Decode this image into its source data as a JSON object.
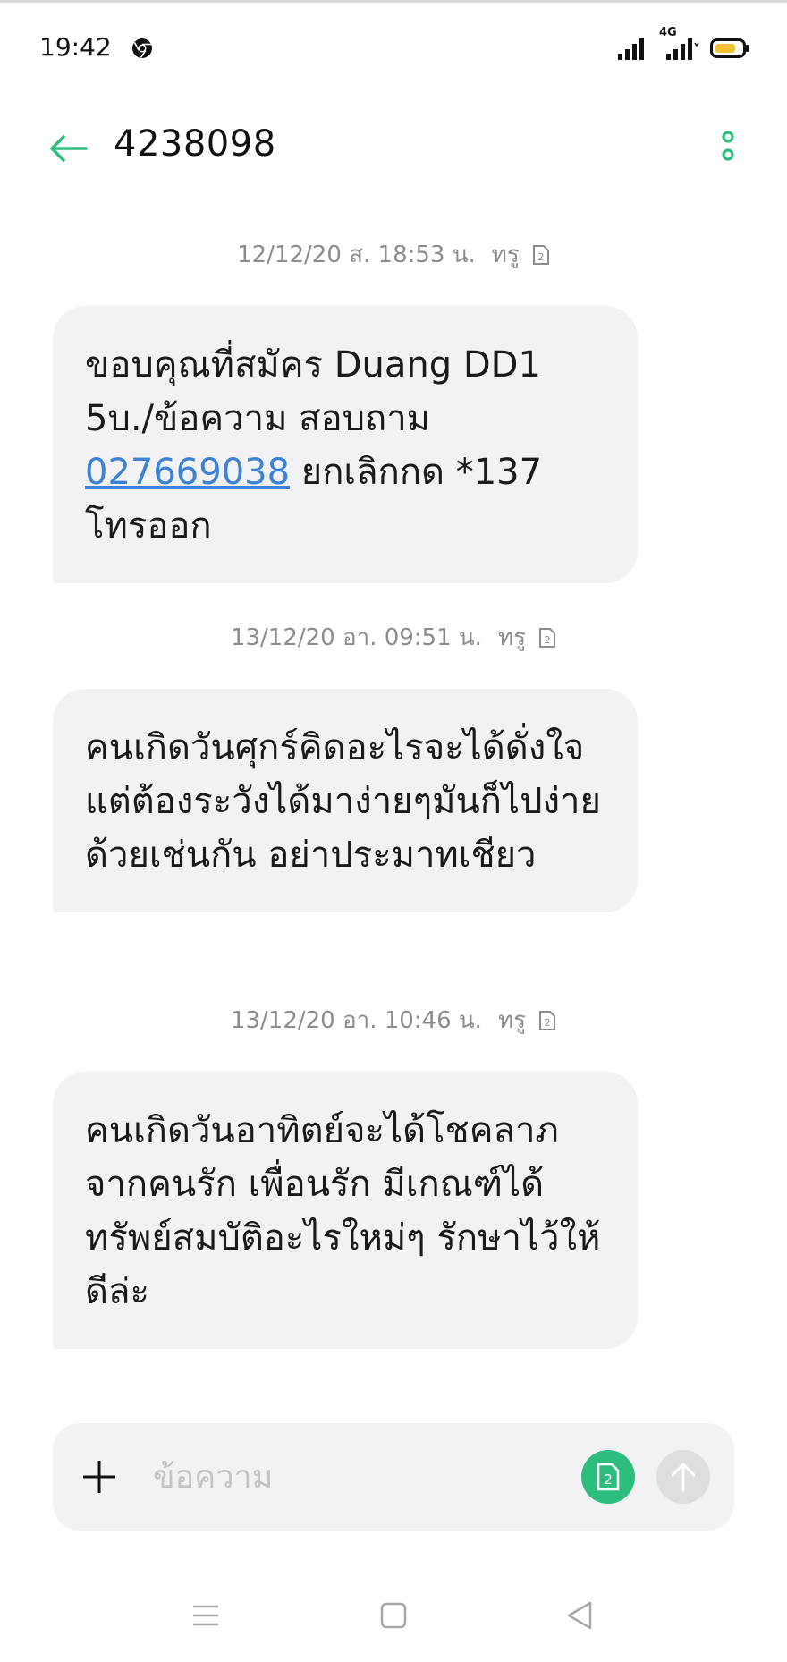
{
  "status_bar": {
    "time": "19:42",
    "network_label": "4G",
    "icons": [
      "chrome-icon",
      "signal-icon",
      "signal-4g-icon",
      "battery-icon"
    ],
    "battery_color": "#f2c230"
  },
  "header": {
    "contact": "4238098",
    "accent_color": "#2dbd7e",
    "icons": [
      "back-arrow-icon",
      "more-vertical-icon"
    ]
  },
  "messages": [
    {
      "timestamp": "12/12/20 ส. 18:53 น.",
      "carrier": "ทรู",
      "sim": "2",
      "text_before": "ขอบคุณที่สมัคร Duang DD1 5บ./ข้อความ สอบถาม ",
      "link": "027669038",
      "text_after": " ยกเลิกกด *137 โทรออก"
    },
    {
      "timestamp": "13/12/20 อา. 09:51 น.",
      "carrier": "ทรู",
      "sim": "2",
      "text": "คนเกิดวันศุกร์คิดอะไรจะได้ดั่งใจ แต่ต้องระวังได้มาง่ายๆมันก็ไปง่ายด้วยเช่นกัน อย่าประมาทเชียว"
    },
    {
      "timestamp": "13/12/20 อา. 10:46 น.",
      "carrier": "ทรู",
      "sim": "2",
      "text": "คนเกิดวันอาทิตย์จะได้โชคลาภจากคนรัก เพื่อนรัก มีเกณฑ์ได้ทรัพย์สมบัติอะไรใหม่ๆ รักษาไว้ให้ดีล่ะ"
    }
  ],
  "composer": {
    "placeholder": "ข้อความ",
    "sim_label": "2",
    "icons": [
      "plus-icon",
      "sim-2-icon",
      "send-arrow-icon"
    ]
  },
  "nav_bar": {
    "icons": [
      "menu-icon",
      "home-square-icon",
      "back-triangle-icon"
    ]
  }
}
